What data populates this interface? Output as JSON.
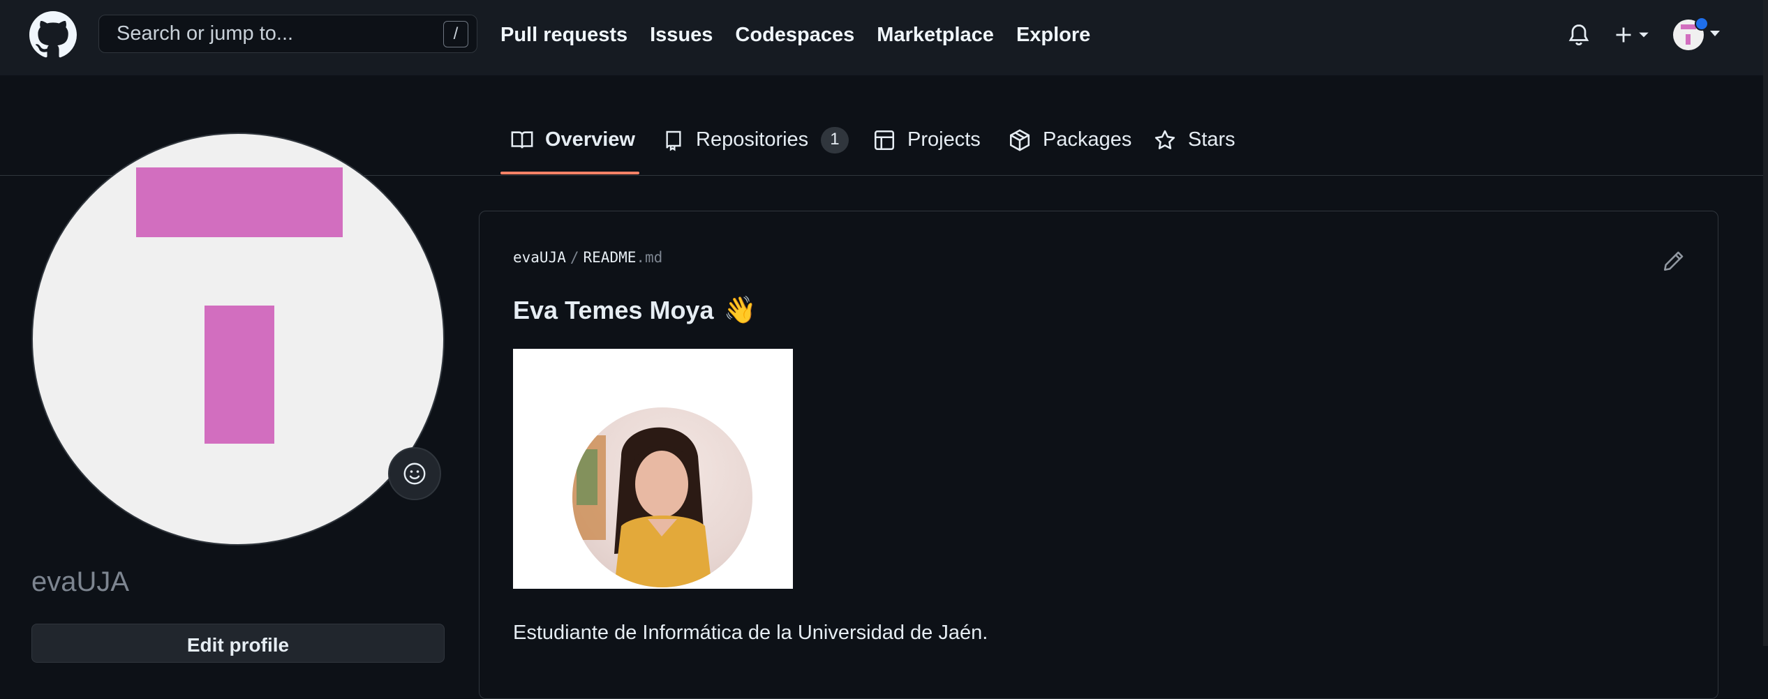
{
  "header": {
    "search_placeholder": "Search or jump to...",
    "search_shortcut": "/",
    "nav": [
      "Pull requests",
      "Issues",
      "Codespaces",
      "Marketplace",
      "Explore"
    ]
  },
  "tabs": [
    {
      "label": "Overview",
      "icon": "book-icon",
      "selected": true
    },
    {
      "label": "Repositories",
      "icon": "repo-icon",
      "count": "1"
    },
    {
      "label": "Projects",
      "icon": "table-icon"
    },
    {
      "label": "Packages",
      "icon": "package-icon"
    },
    {
      "label": "Stars",
      "icon": "star-icon"
    }
  ],
  "profile": {
    "username": "evaUJA",
    "edit_button": "Edit profile",
    "avatar_color": "#d26ebf"
  },
  "readme": {
    "path_user": "evaUJA",
    "path_sep": "/",
    "path_file": "README",
    "path_ext": ".md",
    "title": "Eva Temes Moya",
    "title_emoji": "👋",
    "description": "Estudiante de Informática de la Universidad de Jaén."
  },
  "colors": {
    "accent_underline": "#f78166",
    "notification_dot": "#1f6feb"
  }
}
